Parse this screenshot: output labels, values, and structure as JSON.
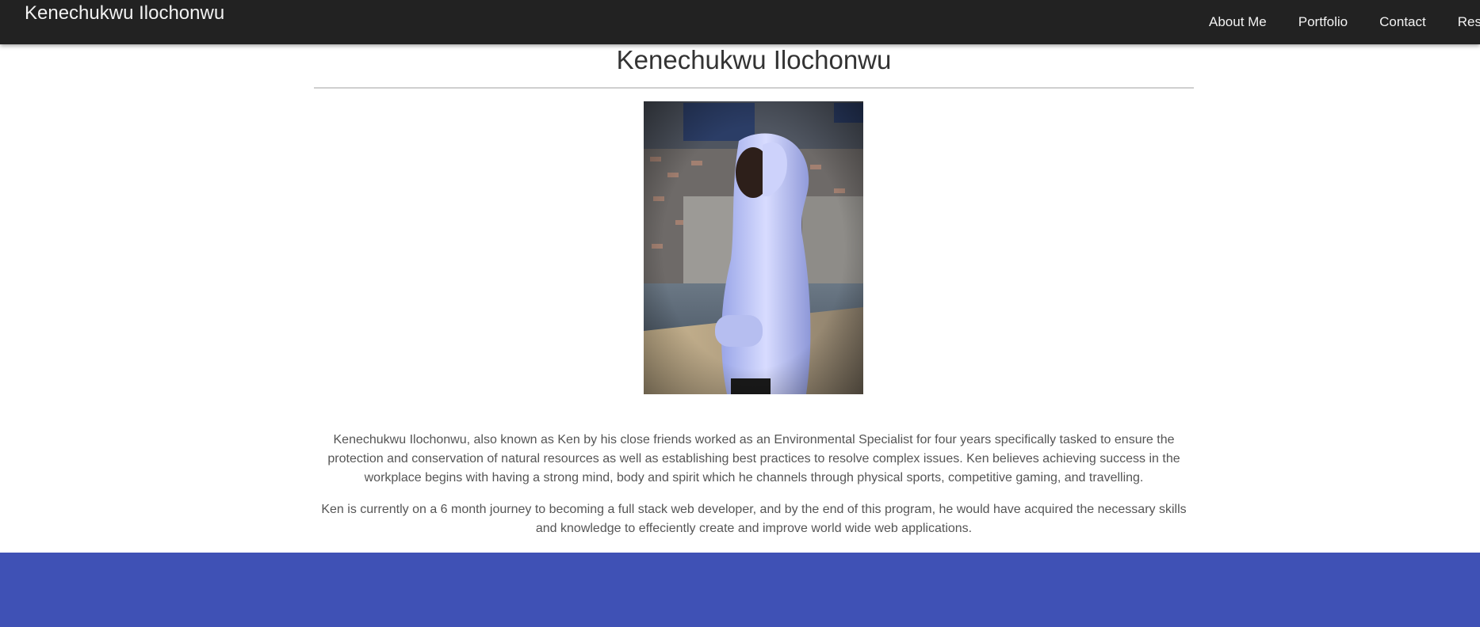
{
  "navbar": {
    "brand": "Kenechukwu Ilochonwu",
    "links": [
      "About Me",
      "Portfolio",
      "Contact",
      "Resu"
    ]
  },
  "main": {
    "title": "Kenechukwu Ilochonwu",
    "paragraph_1": "Kenechukwu Ilochonwu, also known as Ken by his close friends worked as an Environmental Specialist for four years specifically tasked to ensure the protection and conservation of natural resources as well as establishing best practices to resolve complex issues. Ken believes achieving success in the workplace begins with having a strong mind, body and spirit which he channels through physical sports, competitive gaming, and travelling.",
    "paragraph_2": "Ken is currently on a 6 month journey to becoming a full stack web developer, and by the end of this program, he would have acquired the necessary skills and knowledge to effeciently create and improve world wide web applications."
  },
  "colors": {
    "navbar_bg": "#222222",
    "footer_bg": "#3f51b5"
  }
}
